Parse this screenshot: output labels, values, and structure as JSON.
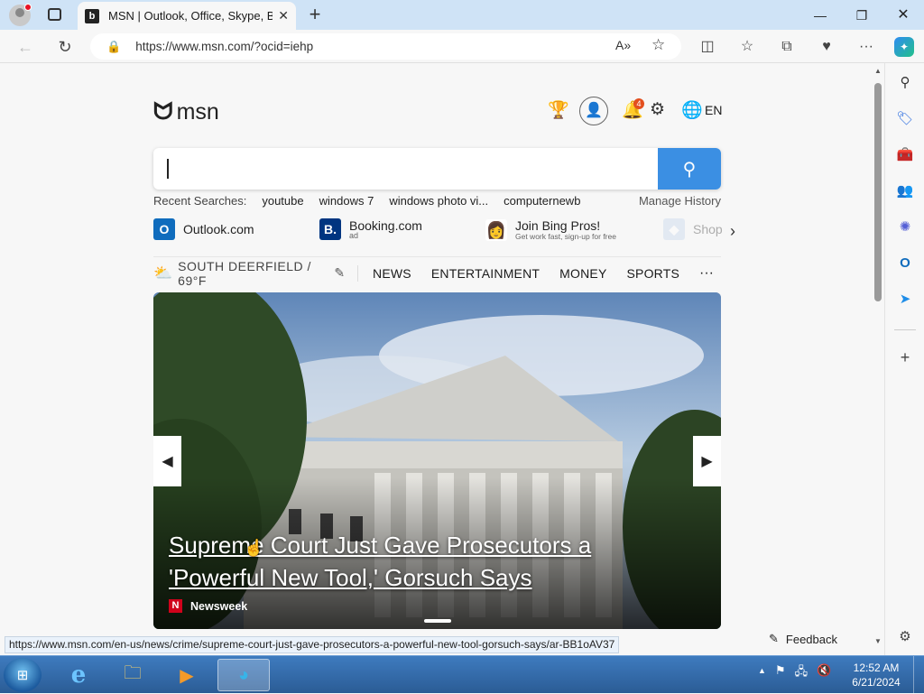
{
  "browser": {
    "tab_title": "MSN | Outlook, Office, Skype, Bi",
    "tab_favicon_letter": "b",
    "url": "https://www.msn.com/?ocid=iehp",
    "new_tab_symbol": "+"
  },
  "header": {
    "logo_text": "msn",
    "notification_count": "4",
    "language": "EN"
  },
  "search": {
    "recent_label": "Recent Searches:",
    "recent_items": [
      "youtube",
      "windows 7",
      "windows photo vi...",
      "computernewb"
    ],
    "manage_history": "Manage History"
  },
  "quicklinks": [
    {
      "icon": "outlook-icon",
      "label": "Outlook.com",
      "sub": "",
      "color": "#0f6cbd"
    },
    {
      "icon": "booking-icon",
      "label": "Booking.com",
      "sub": "ad",
      "color": "#003580"
    },
    {
      "icon": "bing-pros-icon",
      "label": "Join Bing Pros!",
      "sub": "Get work fast, sign-up for free",
      "color": "#ffffff"
    },
    {
      "icon": "shopping-icon",
      "label": "Shop",
      "sub": "",
      "color": "#bcd2ea"
    }
  ],
  "nav": {
    "weather": "SOUTH DEERFIELD / 69°F",
    "items": [
      "NEWS",
      "ENTERTAINMENT",
      "MONEY",
      "SPORTS"
    ],
    "more": "···"
  },
  "hero": {
    "headline_line1": "Supreme Court Just Gave Prosecutors a",
    "headline_line2": "'Powerful New Tool,' Gorsuch Says",
    "source": "Newsweek",
    "source_letter": "N"
  },
  "feedback": "Feedback",
  "status_url": "https://www.msn.com/en-us/news/crime/supreme-court-just-gave-prosecutors-a-powerful-new-tool-gorsuch-says/ar-BB1oAV37",
  "taskbar": {
    "time": "12:52 AM",
    "date": "6/21/2024"
  },
  "colors": {
    "accent": "#3b8fe3",
    "titlebar": "#cfe3f6",
    "taskbar": "#2b5c95"
  }
}
